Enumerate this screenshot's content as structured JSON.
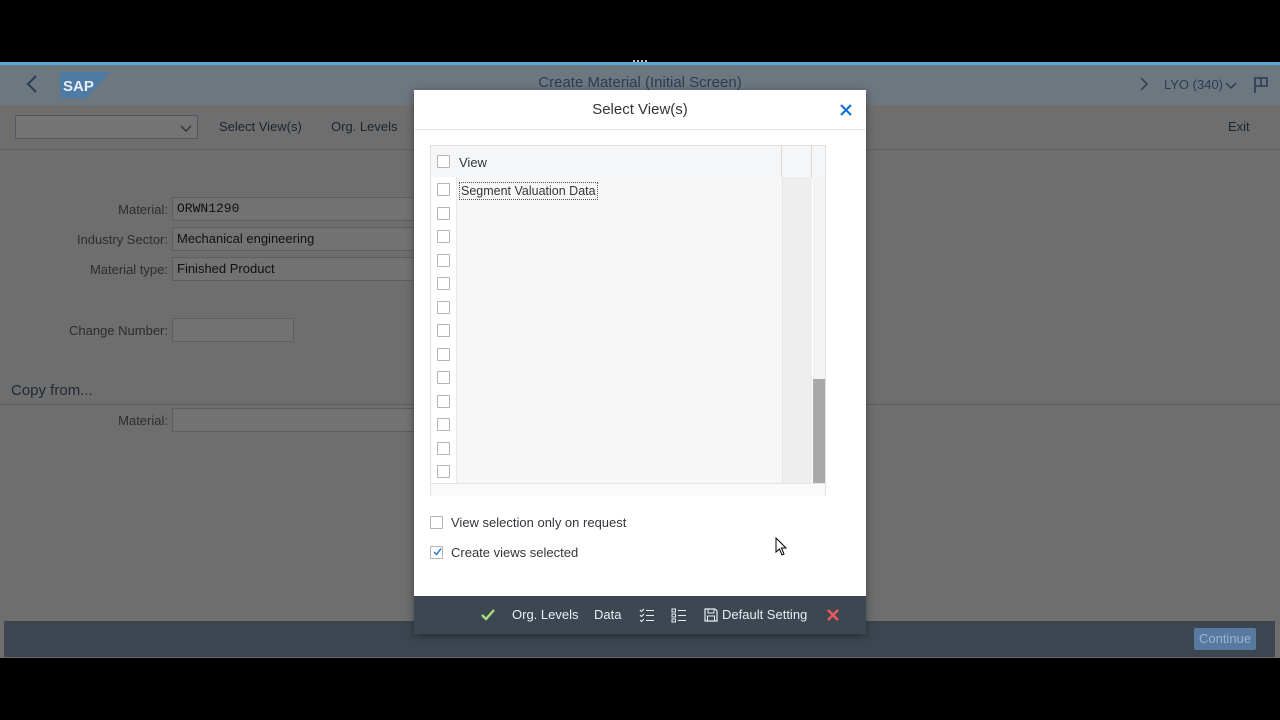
{
  "app": {
    "title": "Create Material (Initial Screen)",
    "system": "LYO (340)",
    "logo_text": "SAP"
  },
  "toolbar": {
    "select_views_label": "Select View(s)",
    "org_levels_label": "Org. Levels",
    "exit_label": "Exit"
  },
  "form": {
    "material_label": "Material:",
    "material_value": "ORWN1290",
    "industry_label": "Industry Sector:",
    "industry_value": "Mechanical engineering",
    "type_label": "Material type:",
    "type_value": "Finished Product",
    "change_number_label": "Change Number:",
    "change_number_value": "",
    "copy_from_title": "Copy from...",
    "copy_material_label": "Material:",
    "copy_material_value": ""
  },
  "footer": {
    "continue_label": "Continue"
  },
  "dialog": {
    "title": "Select View(s)",
    "table": {
      "column_header": "View",
      "rows": [
        {
          "label": "Segment Valuation Data",
          "checked": false
        },
        {
          "label": "",
          "checked": false
        },
        {
          "label": "",
          "checked": false
        },
        {
          "label": "",
          "checked": false
        },
        {
          "label": "",
          "checked": false
        },
        {
          "label": "",
          "checked": false
        },
        {
          "label": "",
          "checked": false
        },
        {
          "label": "",
          "checked": false
        },
        {
          "label": "",
          "checked": false
        },
        {
          "label": "",
          "checked": false
        },
        {
          "label": "",
          "checked": false
        },
        {
          "label": "",
          "checked": false
        },
        {
          "label": "",
          "checked": false
        }
      ],
      "scroll_position": 1.0
    },
    "options": {
      "view_on_request_label": "View selection only on request",
      "view_on_request_checked": false,
      "create_selected_label": "Create views selected",
      "create_selected_checked": true
    },
    "footer": {
      "org_levels_label": "Org. Levels",
      "data_label": "Data",
      "default_setting_label": "Default Setting"
    }
  },
  "colors": {
    "accent": "#0a6ed1",
    "confirm": "#a7e07a",
    "cancel": "#e85a5a",
    "dialog_footer": "#3c4752"
  }
}
